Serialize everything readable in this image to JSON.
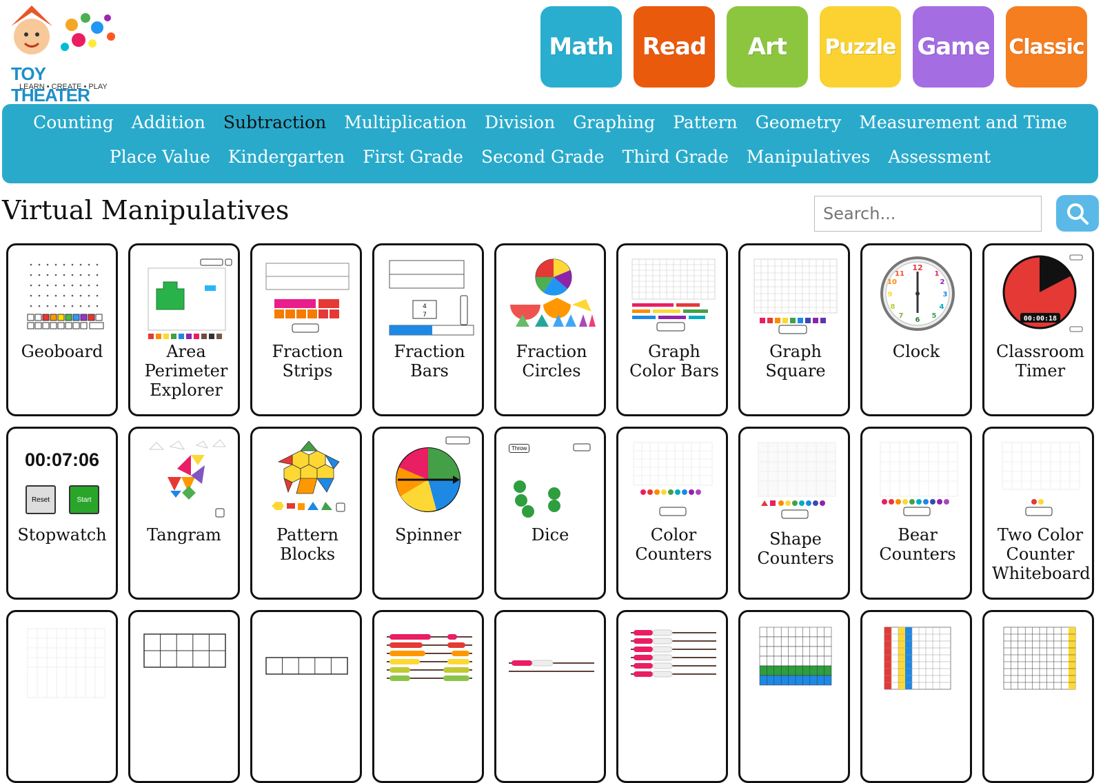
{
  "logo": {
    "title": "TOY THEATER",
    "tagline": "LEARN • CREATE • PLAY"
  },
  "categories": [
    {
      "label": "Math",
      "color": "#2aaed0"
    },
    {
      "label": "Read",
      "color": "#ea5a0c"
    },
    {
      "label": "Art",
      "color": "#8cc63f"
    },
    {
      "label": "Puzzle",
      "color": "#fbd231"
    },
    {
      "label": "Game",
      "color": "#a56de2"
    },
    {
      "label": "Classic",
      "color": "#f57e21"
    }
  ],
  "nav": {
    "row1": [
      "Counting",
      "Addition",
      "Subtraction",
      "Multiplication",
      "Division",
      "Graphing",
      "Pattern",
      "Geometry",
      "Measurement and Time"
    ],
    "row2": [
      "Place Value",
      "Kindergarten",
      "First Grade",
      "Second Grade",
      "Third Grade",
      "Manipulatives",
      "Assessment"
    ],
    "active": "Subtraction"
  },
  "page_title": "Virtual Manipulatives",
  "search": {
    "placeholder": "Search..."
  },
  "cards": [
    {
      "label": "Geoboard"
    },
    {
      "label": "Area Perimeter Explorer"
    },
    {
      "label": "Fraction Strips"
    },
    {
      "label": "Fraction Bars"
    },
    {
      "label": "Fraction Circles"
    },
    {
      "label": "Graph Color Bars"
    },
    {
      "label": "Graph Square"
    },
    {
      "label": "Clock"
    },
    {
      "label": "Classroom Timer",
      "timer": "00:00:18"
    },
    {
      "label": "Stopwatch",
      "time": "00:07:06",
      "reset": "Reset",
      "start": "Start"
    },
    {
      "label": "Tangram"
    },
    {
      "label": "Pattern Blocks"
    },
    {
      "label": "Spinner"
    },
    {
      "label": "Dice",
      "throw": "Throw"
    },
    {
      "label": "Color Counters"
    },
    {
      "label": "Shape Counters"
    },
    {
      "label": "Bear Counters"
    },
    {
      "label": "Two Color Counter Whiteboard"
    },
    {
      "label": ""
    },
    {
      "label": ""
    },
    {
      "label": ""
    },
    {
      "label": ""
    },
    {
      "label": ""
    },
    {
      "label": ""
    },
    {
      "label": ""
    },
    {
      "label": ""
    },
    {
      "label": ""
    }
  ]
}
